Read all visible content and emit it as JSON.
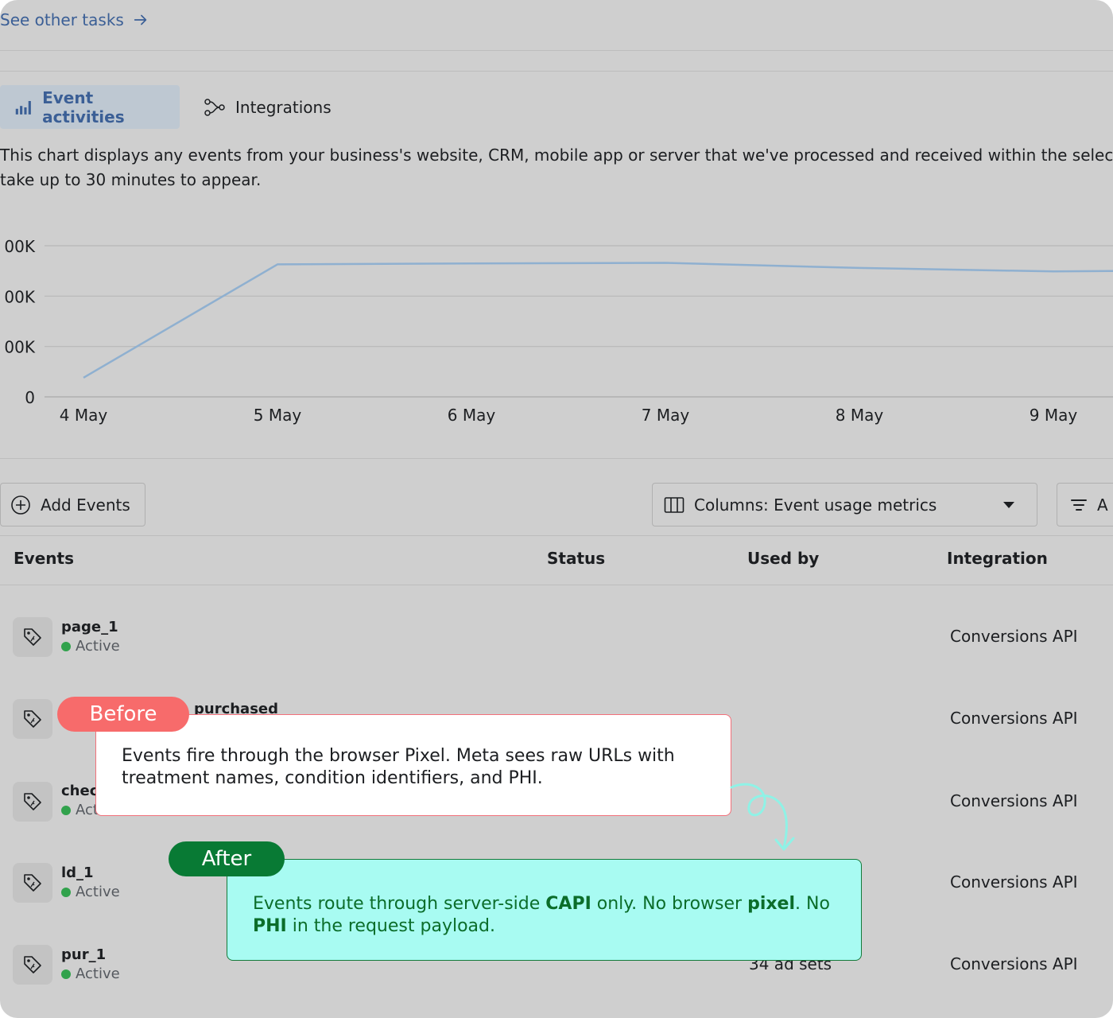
{
  "header": {
    "see_other_tasks": "See other tasks"
  },
  "tabs": [
    {
      "label": "Event activities",
      "active": true
    },
    {
      "label": "Integrations",
      "active": false
    }
  ],
  "description": {
    "line1": "This chart displays any events from your business's website, CRM, mobile app or server that we've processed and received within the selected dat",
    "line2": "take up to 30 minutes to appear."
  },
  "chart_data": {
    "type": "line",
    "x": [
      "4 May",
      "5 May",
      "6 May",
      "7 May",
      "8 May",
      "9 May",
      ""
    ],
    "y_tick_labels": [
      "0",
      "00K",
      "00K",
      "00K"
    ],
    "series": [
      {
        "values": [
          0.38,
          2.63,
          2.65,
          2.66,
          2.56,
          2.49,
          2.5
        ]
      }
    ],
    "ylim": [
      0,
      3
    ],
    "grid": true,
    "line_color": "#8fb0d0"
  },
  "toolbar": {
    "add_events": "Add Events",
    "columns": "Columns: Event usage metrics",
    "filter_label": "A"
  },
  "table": {
    "headers": {
      "events": "Events",
      "status": "Status",
      "used_by": "Used by",
      "integration": "Integration"
    },
    "rows": [
      {
        "name": "page_1",
        "status": "Active",
        "used_by": "",
        "integration": "Conversions API"
      },
      {
        "name": "purchased",
        "status": "",
        "used_by": "",
        "integration": "Conversions API"
      },
      {
        "name": "checl",
        "status": "Act",
        "used_by": "",
        "integration": "Conversions API"
      },
      {
        "name": "ld_1",
        "status": "Active",
        "used_by": "",
        "integration": "Conversions API"
      },
      {
        "name": "pur_1",
        "status": "Active",
        "used_by": "34 ad sets",
        "integration": "Conversions API"
      }
    ]
  },
  "callouts": {
    "before": {
      "pill": "Before",
      "text": "Events fire through the browser Pixel. Meta sees raw URLs with treatment names, condition identifiers, and PHI."
    },
    "after": {
      "pill": "After",
      "text_parts": [
        "Events route through server-side ",
        "CAPI",
        " only. No browser ",
        "pixel",
        ". No ",
        "PHI",
        " in the request payload."
      ]
    }
  },
  "colors": {
    "accent": "#3b5f96",
    "before": "#f76b6b",
    "after": "#087a34",
    "after_bg": "#a8fbf2"
  }
}
